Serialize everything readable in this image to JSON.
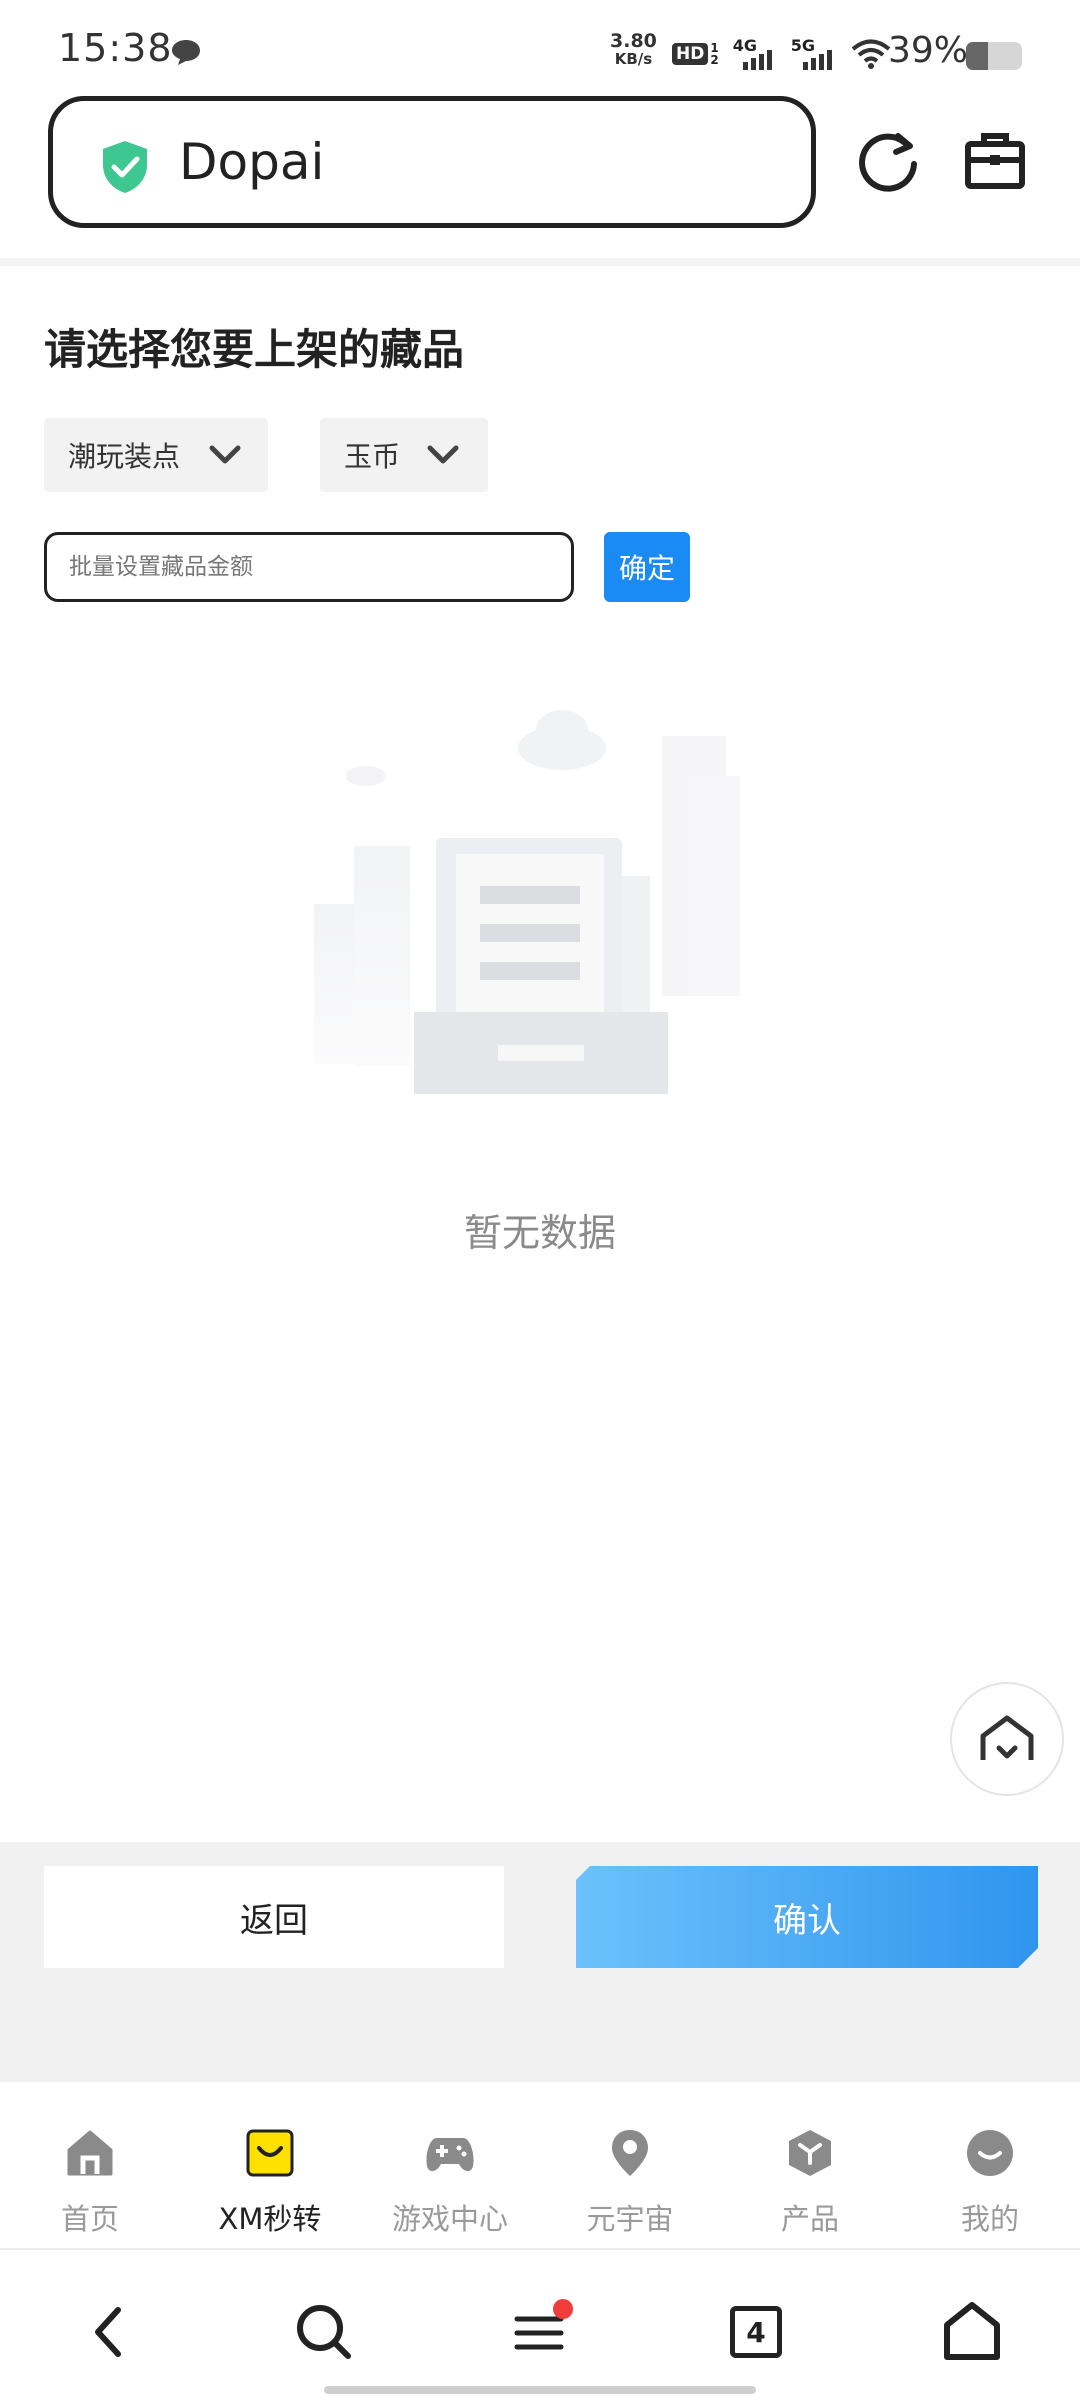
{
  "status_bar": {
    "time": "15:38",
    "net_speed_value": "3.80",
    "net_speed_unit": "KB/s",
    "hd_label": "HD",
    "network_4g": "4G",
    "network_5g": "5G",
    "battery_percent_text": "39%",
    "battery_level": 0.39
  },
  "url_bar": {
    "site_name": "Dopai",
    "shield_color": "#3fc792"
  },
  "page": {
    "title": "请选择您要上架的藏品",
    "category_dropdown": "潮玩装点",
    "currency_dropdown": "玉币",
    "amount_placeholder": "批量设置藏品金额",
    "ok_button": "确定",
    "empty_text": "暂无数据"
  },
  "actions": {
    "back": "返回",
    "confirm": "确认"
  },
  "bottom_nav": [
    {
      "label": "首页",
      "icon": "home-icon"
    },
    {
      "label": "XM秒转",
      "icon": "bag-smile-icon",
      "active": true
    },
    {
      "label": "游戏中心",
      "icon": "gamepad-icon"
    },
    {
      "label": "元宇宙",
      "icon": "location-pin-icon"
    },
    {
      "label": "产品",
      "icon": "cube-icon"
    },
    {
      "label": "我的",
      "icon": "smile-face-icon"
    }
  ],
  "browser_bar": {
    "tab_count": "4",
    "menu_badge_color": "#f23c3c"
  },
  "colors": {
    "accent_blue": "#1a8af5",
    "active_nav_yellow": "#ffe100"
  }
}
